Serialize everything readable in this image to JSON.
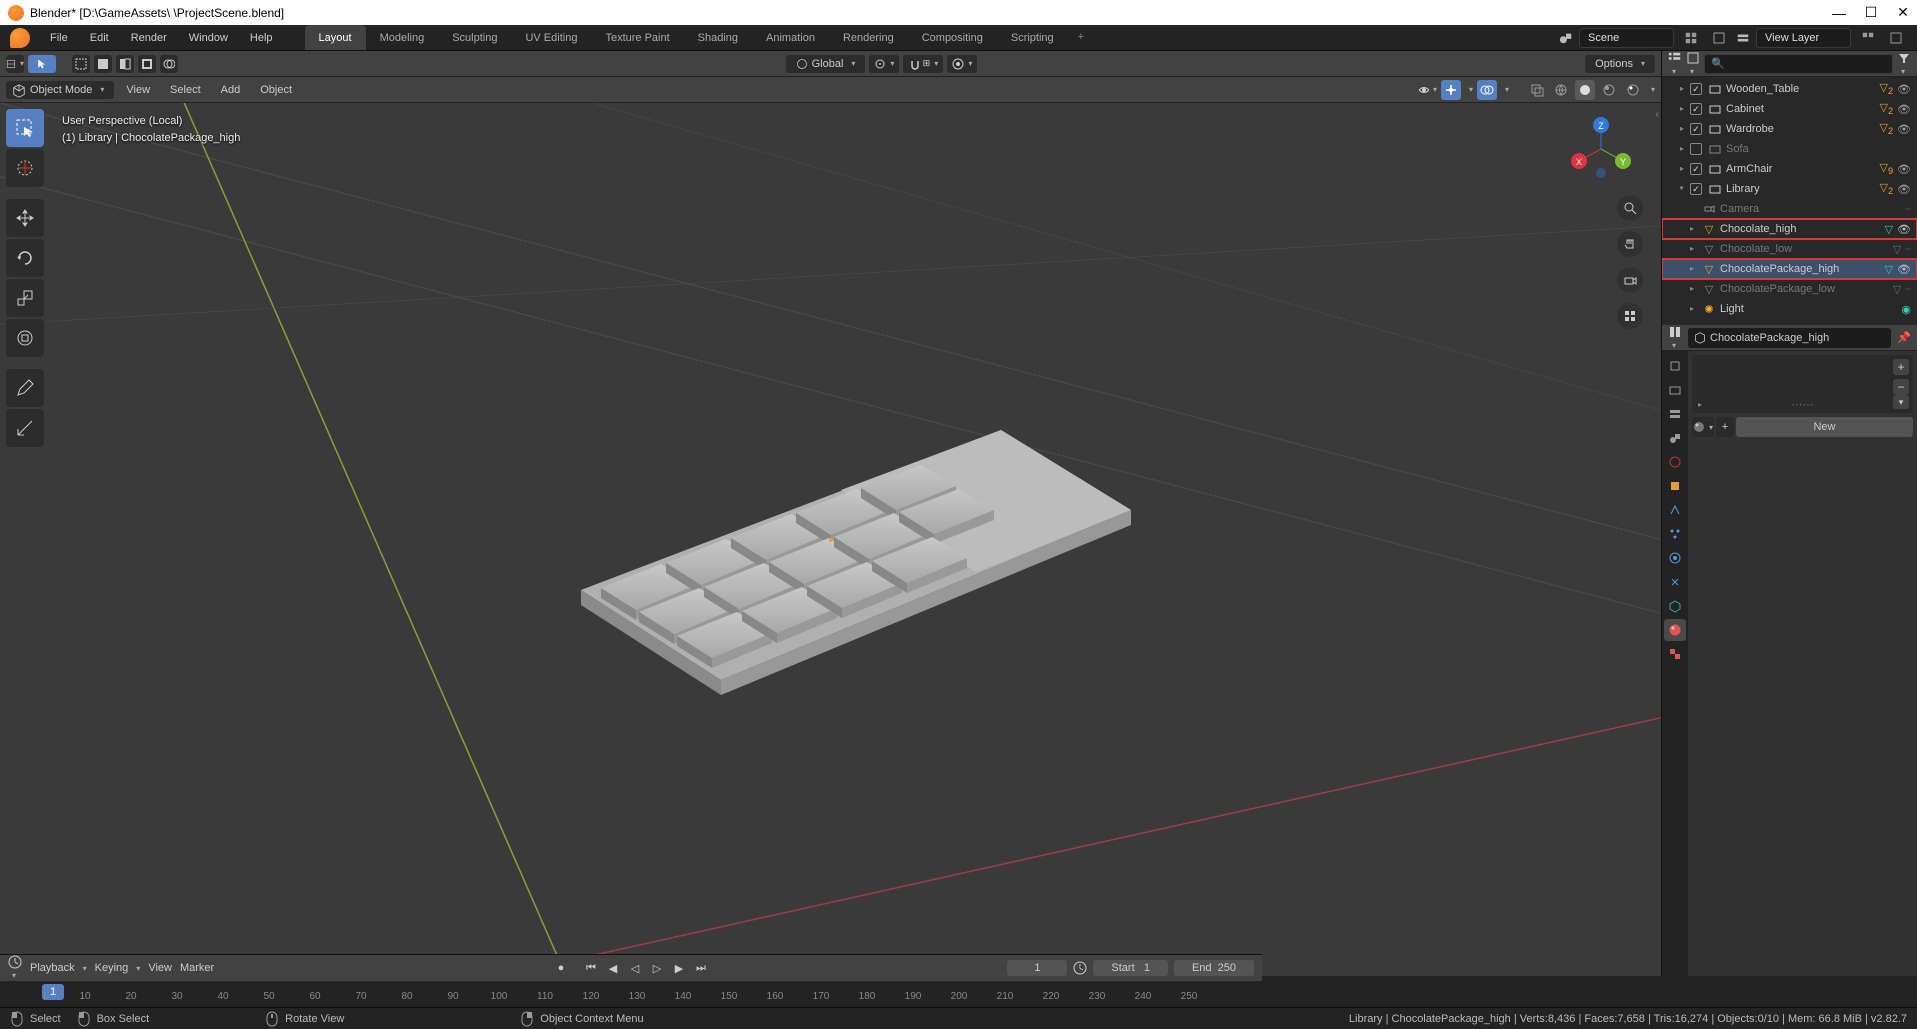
{
  "titlebar": {
    "app": "Blender*",
    "path": "[D:\\GameAssets\\            \\ProjectScene.blend]",
    "win_min": "—",
    "win_max": "☐",
    "win_close": "✕"
  },
  "main_menu": {
    "file": "File",
    "edit": "Edit",
    "render": "Render",
    "window": "Window",
    "help": "Help"
  },
  "workspaces": {
    "tabs": [
      "Layout",
      "Modeling",
      "Sculpting",
      "UV Editing",
      "Texture Paint",
      "Shading",
      "Animation",
      "Rendering",
      "Compositing",
      "Scripting"
    ],
    "add": "+"
  },
  "header_right": {
    "scene": "Scene",
    "view_layer": "View Layer"
  },
  "vp_header": {
    "orientation": "Global",
    "options": "Options"
  },
  "mode_header": {
    "mode": "Object Mode",
    "view": "View",
    "select": "Select",
    "add": "Add",
    "object": "Object"
  },
  "viewport": {
    "line1": "User Perspective (Local)",
    "line2": "(1) Library | ChocolatePackage_high",
    "axis_x": "X",
    "axis_y": "Y",
    "axis_z": "Z"
  },
  "outliner": {
    "items": [
      {
        "name": "Wooden_Table",
        "type": "collection",
        "enabled": true,
        "sub": "2"
      },
      {
        "name": "Cabinet",
        "type": "collection",
        "enabled": true,
        "sub": "2"
      },
      {
        "name": "Wardrobe",
        "type": "collection",
        "enabled": true,
        "sub": "2"
      },
      {
        "name": "Sofa",
        "type": "collection",
        "enabled": false
      },
      {
        "name": "ArmChair",
        "type": "collection",
        "enabled": true,
        "sub": "9"
      },
      {
        "name": "Library",
        "type": "collection",
        "enabled": true,
        "sub": "2",
        "expanded": true
      },
      {
        "name": "Camera",
        "type": "camera",
        "indent": 1,
        "disabled": true
      },
      {
        "name": "Chocolate_high",
        "type": "mesh",
        "indent": 1,
        "hl": true,
        "mod": true
      },
      {
        "name": "Chocolate_low",
        "type": "mesh",
        "indent": 1,
        "disabled": true,
        "mod": true
      },
      {
        "name": "ChocolatePackage_high",
        "type": "mesh",
        "indent": 1,
        "hl": true,
        "sel": true,
        "mod": true
      },
      {
        "name": "ChocolatePackage_low",
        "type": "mesh",
        "indent": 1,
        "disabled": true,
        "mod": true
      },
      {
        "name": "Light",
        "type": "light",
        "indent": 1
      }
    ]
  },
  "properties": {
    "breadcrumb_obj": "ChocolatePackage_high",
    "new": "New"
  },
  "timeline": {
    "playback": "Playback",
    "keying": "Keying",
    "view": "View",
    "marker": "Marker",
    "current": "1",
    "start_lbl": "Start",
    "start": "1",
    "end_lbl": "End",
    "end": "250",
    "ticks": [
      "1",
      "10",
      "20",
      "30",
      "40",
      "50",
      "60",
      "70",
      "80",
      "90",
      "100",
      "110",
      "120",
      "130",
      "140",
      "150",
      "160",
      "170",
      "180",
      "190",
      "200",
      "210",
      "220",
      "230",
      "240",
      "250"
    ]
  },
  "status": {
    "select": "Select",
    "box": "Box Select",
    "rotate": "Rotate View",
    "ctx": "Object Context Menu",
    "right": "Library | ChocolatePackage_high | Verts:8,436 | Faces:7,658 | Tris:16,274 | Objects:0/10 | Mem: 66.8 MiB | v2.82.7"
  },
  "glyph": {
    "chev_down": "▾",
    "chev_right": "▸",
    "search": "🔍",
    "funnel": "⧩",
    "eye": "👁",
    "play": "▶",
    "rec": "●",
    "skip_start": "⏮",
    "prev_key": "◀",
    "prev_frame": "◁",
    "next_frame": "▷",
    "next_key": "▶",
    "skip_end": "⏭",
    "plus": "+",
    "minus": "−"
  }
}
